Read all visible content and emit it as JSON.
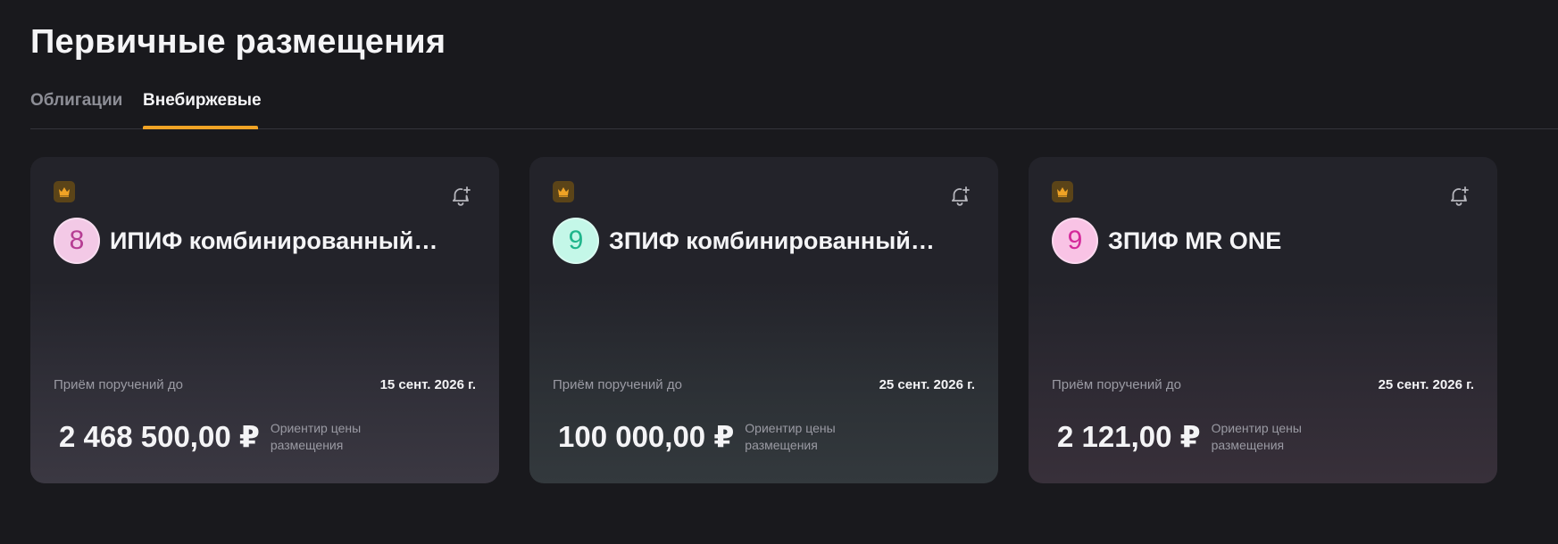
{
  "page": {
    "title": "Первичные размещения"
  },
  "tabs": [
    {
      "label": "Облигации",
      "active": false
    },
    {
      "label": "Внебиржевые",
      "active": true
    }
  ],
  "colors": {
    "accent": "#f0a325",
    "background": "#19191d",
    "card": "#23232a",
    "crown_badge": "#5b4418"
  },
  "icons": {
    "premium": "crown-icon",
    "notify": "bell-plus-icon"
  },
  "cards": [
    {
      "rating": "8",
      "rating_bg": "#f3c9e6",
      "rating_color": "#b63d93",
      "name": "ИПИФ комбинированный…",
      "deadline_label": "Приём поручений до",
      "deadline_date": "15 сент. 2026 г.",
      "price": "2 468 500,00 ₽",
      "price_caption": "Ориентир цены размещения"
    },
    {
      "rating": "9",
      "rating_bg": "#c4f7e8",
      "rating_color": "#1fb58b",
      "name": "ЗПИФ комбинированный…",
      "deadline_label": "Приём поручений до",
      "deadline_date": "25 сент. 2026 г.",
      "price": "100 000,00 ₽",
      "price_caption": "Ориентир цены размещения"
    },
    {
      "rating": "9",
      "rating_bg": "#f9c3e5",
      "rating_color": "#d4289a",
      "name": "ЗПИФ MR ONE",
      "deadline_label": "Приём поручений до",
      "deadline_date": "25 сент. 2026 г.",
      "price": "2 121,00 ₽",
      "price_caption": "Ориентир цены размещения"
    }
  ]
}
